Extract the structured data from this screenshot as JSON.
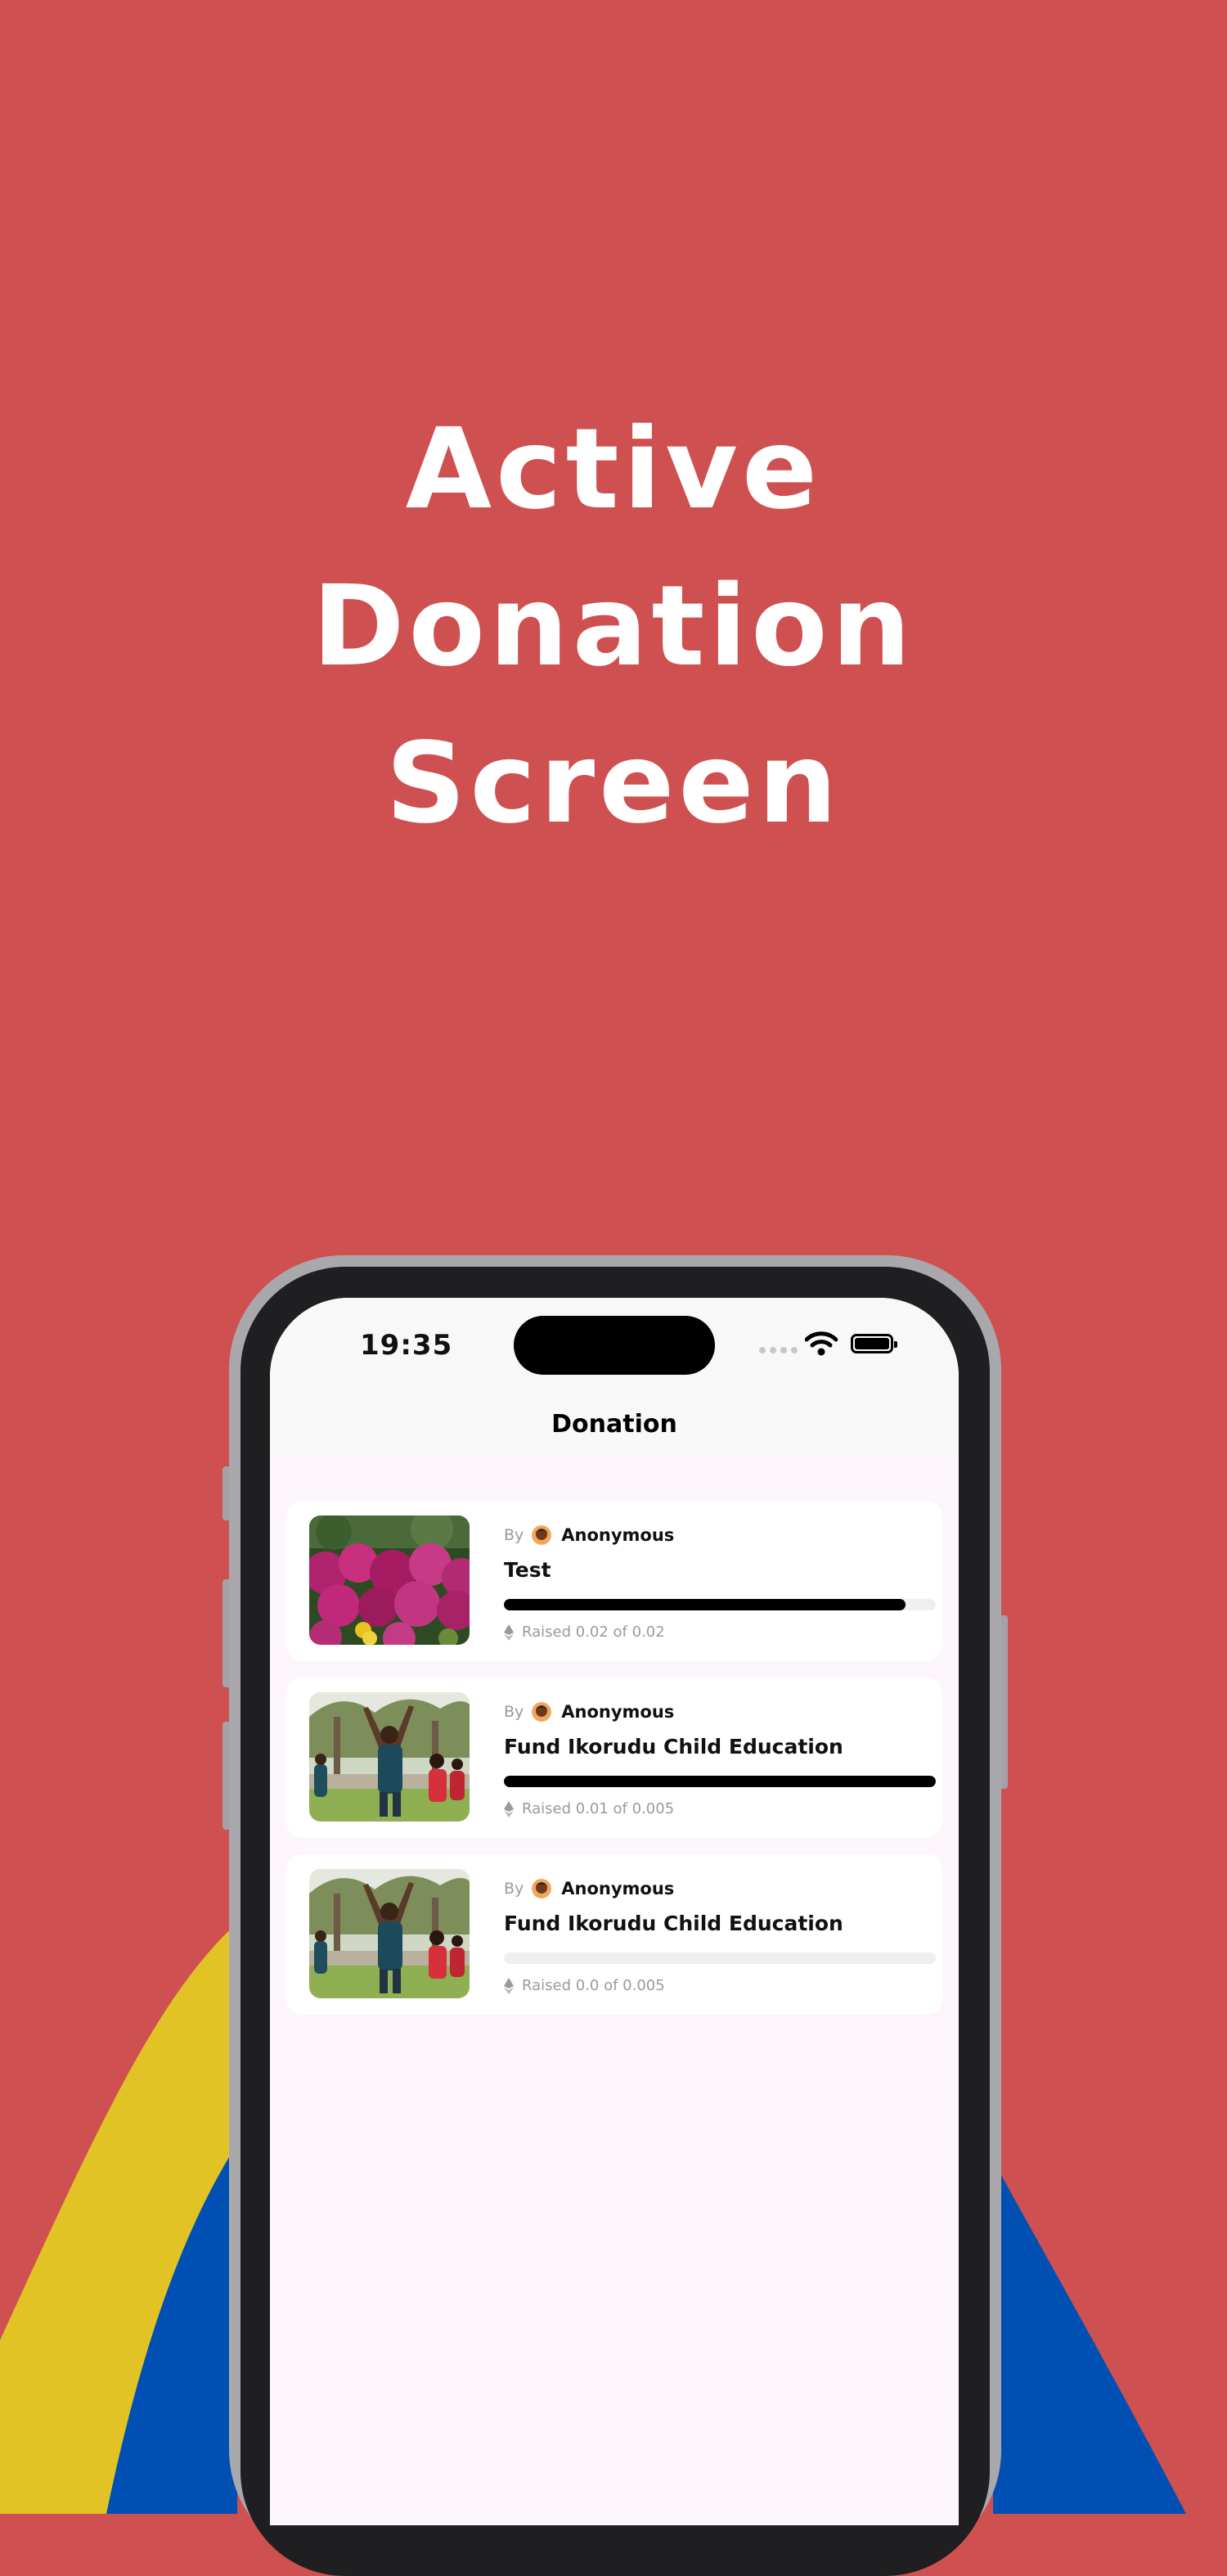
{
  "headline": {
    "line1": "Active",
    "line2": "Donation",
    "line3": "Screen"
  },
  "status_bar": {
    "time": "19:35"
  },
  "nav": {
    "title": "Donation"
  },
  "colors": {
    "background": "#CF5050",
    "yellow_shape": "#E2C325",
    "blue_shape": "#0050B4",
    "progress": "#000000"
  },
  "donations": [
    {
      "by_label": "By",
      "author": "Anonymous",
      "title": "Test",
      "raised": "Raised 0.02 of 0.02",
      "progress": 0.93,
      "image": "flowers"
    },
    {
      "by_label": "By",
      "author": "Anonymous",
      "title": "Fund Ikorudu Child Education",
      "raised": "Raised 0.01 of 0.005",
      "progress": 1.0,
      "image": "people-outdoors"
    },
    {
      "by_label": "By",
      "author": "Anonymous",
      "title": "Fund Ikorudu Child Education",
      "raised": "Raised 0.0 of 0.005",
      "progress": 0.0,
      "image": "people-outdoors"
    }
  ]
}
